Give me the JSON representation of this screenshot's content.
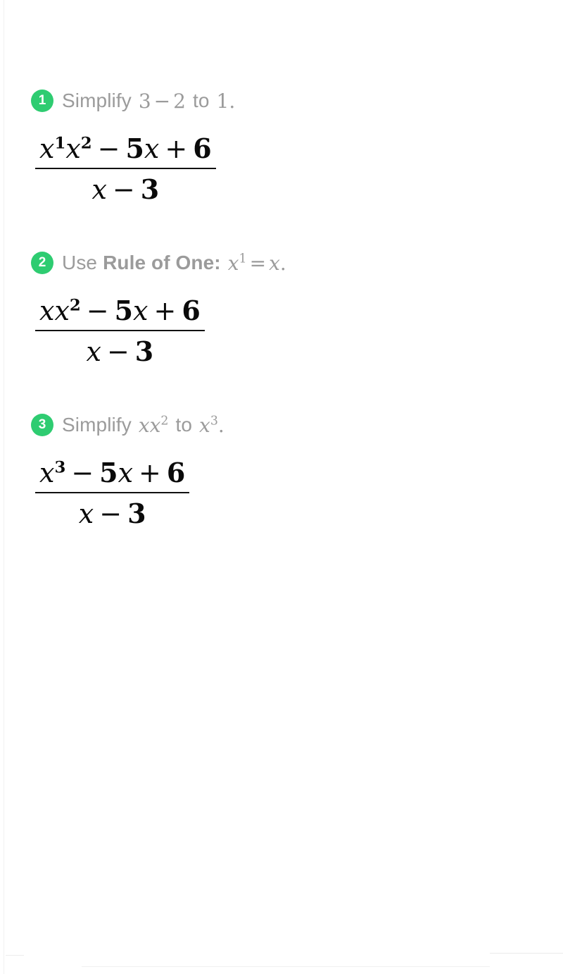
{
  "document": {
    "type": "math-solution-steps",
    "accent_color": "#2ecc71",
    "heading_text_color": "#9b9b9b",
    "math_text_color": "#0a0a0a"
  },
  "steps": [
    {
      "badge": "1",
      "heading": {
        "lead": "Simplify",
        "expr_from": "3 − 2",
        "connector": "to",
        "expr_to": "1."
      },
      "expression": {
        "numerator": "x¹x² − 5x + 6",
        "denominator": "x − 3"
      }
    },
    {
      "badge": "2",
      "heading": {
        "lead": "Use",
        "rule_name": "Rule of One:",
        "expr_rule": "x¹ = x."
      },
      "expression": {
        "numerator": "xx² − 5x + 6",
        "denominator": "x − 3"
      }
    },
    {
      "badge": "3",
      "heading": {
        "lead": "Simplify",
        "expr_from": "xx²",
        "connector": "to",
        "expr_to": "x³."
      },
      "expression": {
        "numerator": "x³ − 5x + 6",
        "denominator": "x − 3"
      }
    }
  ],
  "tokens": {
    "x": "x",
    "sup1": "1",
    "sup2": "2",
    "sup3": "3",
    "minus": "−",
    "plus": "+",
    "equals": "=",
    "five": "5",
    "six": "6",
    "three": "3",
    "two": "2",
    "one": "1",
    "period": ".",
    "to": "to"
  }
}
